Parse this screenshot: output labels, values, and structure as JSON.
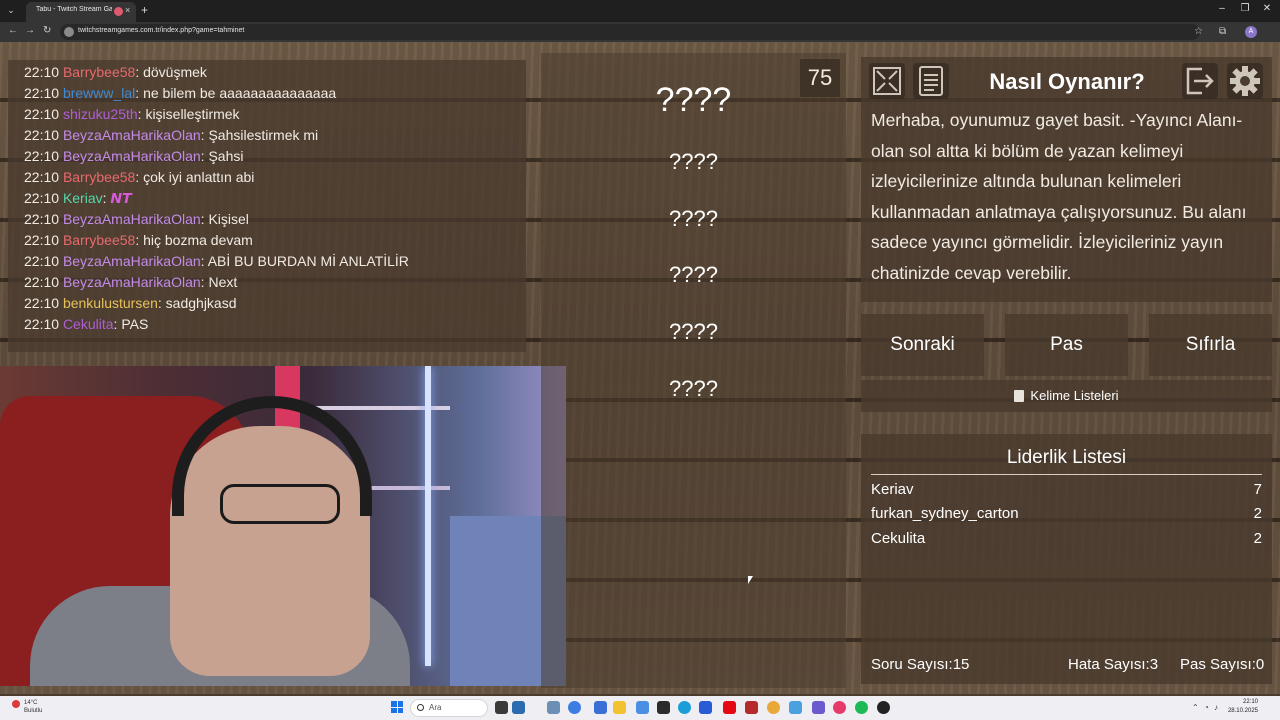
{
  "browser": {
    "tab_title": "Tabu - Twitch Stream Games",
    "tab_close": "×",
    "new_tab": "+",
    "url": "twitchstreamgames.com.tr/index.php?game=tahminet",
    "menu_glyph": "⌄",
    "back": "←",
    "forward": "→",
    "reload": "↻",
    "star": "☆",
    "extensions": "⧉",
    "profile": "A",
    "minimize": "–",
    "maximize": "❐",
    "close": "✕"
  },
  "chat": [
    {
      "time": "22:10",
      "user": "Barrybee58",
      "color": "#e8696d",
      "message": "dövüşmek"
    },
    {
      "time": "22:10",
      "user": "brewww_lal",
      "color": "#3f8ad8",
      "message": "ne bilem be aaaaaaaaaaaaaaa"
    },
    {
      "time": "22:10",
      "user": "shizuku25th",
      "color": "#b05ed6",
      "message": "kişiselleştirmek"
    },
    {
      "time": "22:10",
      "user": "BeyzaAmaHarikaOlan",
      "color": "#c38be8",
      "message": "Şahsilestirmek mi"
    },
    {
      "time": "22:10",
      "user": "BeyzaAmaHarikaOlan",
      "color": "#c38be8",
      "message": "Şahsi"
    },
    {
      "time": "22:10",
      "user": "Barrybee58",
      "color": "#e8696d",
      "message": "çok iyi anlattın abi"
    },
    {
      "time": "22:10",
      "user": "Keriav",
      "color": "#56d6a9",
      "message": "𝙉𝙏"
    },
    {
      "time": "22:10",
      "user": "BeyzaAmaHarikaOlan",
      "color": "#c38be8",
      "message": "Kişisel"
    },
    {
      "time": "22:10",
      "user": "Barrybee58",
      "color": "#e8696d",
      "message": "hiç bozma devam"
    },
    {
      "time": "22:10",
      "user": "BeyzaAmaHarikaOlan",
      "color": "#c38be8",
      "message": "ABİ BU BURDAN Mİ ANLATİLİR"
    },
    {
      "time": "22:10",
      "user": "BeyzaAmaHarikaOlan",
      "color": "#c38be8",
      "message": "Next"
    },
    {
      "time": "22:10",
      "user": "benkulustursen",
      "color": "#e6c15a",
      "message": "sadghjkasd"
    },
    {
      "time": "22:10",
      "user": "Cekulita",
      "color": "#b05ed6",
      "message": "PAS"
    }
  ],
  "game": {
    "timer": "75",
    "main_word": "????",
    "taboo_words": [
      "????",
      "????",
      "????",
      "????",
      "????"
    ]
  },
  "info": {
    "title": "Nasıl Oynanır?",
    "text": "Merhaba, oyunumuz gayet basit. -Yayıncı Alanı- olan sol altta ki bölüm de yazan kelimeyi izleyicilerinize altında bulunan kelimeleri kullanmadan anlatmaya çalışıyorsunuz. Bu alanı sadece yayıncı görmelidir. İzleyicileriniz yayın chatinizde cevap verebilir.",
    "icons": [
      "fullscreen-icon",
      "document-icon",
      "exit-icon",
      "gear-icon"
    ]
  },
  "actions": {
    "next": "Sonraki",
    "pass": "Pas",
    "reset": "Sıfırla",
    "word_lists": "Kelime Listeleri"
  },
  "leaderboard": {
    "title": "Liderlik Listesi",
    "rows": [
      {
        "name": "Keriav",
        "score": "7"
      },
      {
        "name": "furkan_sydney_carton",
        "score": "2"
      },
      {
        "name": "Cekulita",
        "score": "2"
      }
    ]
  },
  "stats": {
    "questions_label": "Soru Sayısı:",
    "questions": "15",
    "errors_label": "Hata Sayısı:",
    "errors": "3",
    "passes_label": "Pas Sayısı:",
    "passes": "0"
  },
  "taskbar": {
    "weather_temp": "14°C",
    "weather_desc": "Bulutlu",
    "search_placeholder": "Ara",
    "time": "22:10",
    "date": "28.10.2025"
  }
}
